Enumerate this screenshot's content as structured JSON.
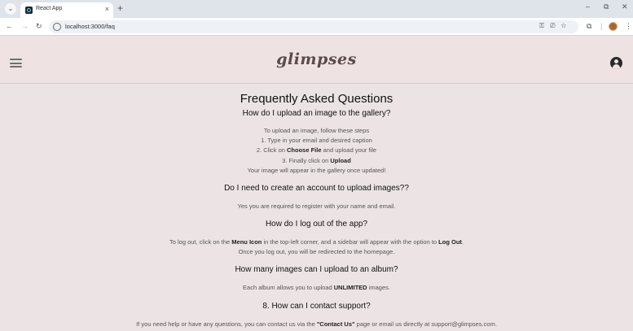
{
  "browser": {
    "tab_title": "React App",
    "tab_close": "×",
    "new_tab": "+",
    "url": "localhost:3000/faq",
    "window_controls": {
      "minimize": "–",
      "restore": "⧉",
      "close": "✕"
    },
    "nav": {
      "back": "←",
      "forward": "→",
      "reload": "↻"
    }
  },
  "header": {
    "logo": "glimpses"
  },
  "faq": {
    "title": "Frequently Asked Questions",
    "items": [
      {
        "question": "How do I upload an image to the gallery?",
        "lines": [
          [
            "To upload an image, follow these steps"
          ],
          [
            "1. Type in your email and desired caption"
          ],
          [
            "2. Click on ",
            "Choose File",
            " and upload your file"
          ],
          [
            "3. Finally click on ",
            "Upload"
          ],
          [
            "Your image will appear in the gallery once updated!"
          ]
        ]
      },
      {
        "question": "Do I need to create an account to upload images??",
        "lines": [
          [
            "Yes you are required to register with your name and email."
          ]
        ]
      },
      {
        "question": "How do I log out of the app?",
        "lines": [
          [
            "To log out, click on the ",
            "Menu Icon",
            " in the top-left corner, and a sidebar will appear with the option to ",
            "Log Out",
            "."
          ],
          [
            "Once you log out, you will be redirected to the homepage."
          ]
        ]
      },
      {
        "question": "How many images can I upload to an album?",
        "lines": [
          [
            "Each album allows you to upload ",
            "UNLIMITED",
            " images."
          ]
        ]
      },
      {
        "question": "8. How can I contact support?",
        "lines": [
          [
            "If you need help or have any questions, you can contact us via the ",
            "\"Contact Us\"",
            " page or email us directly at support@glimpses.com."
          ]
        ]
      }
    ]
  }
}
